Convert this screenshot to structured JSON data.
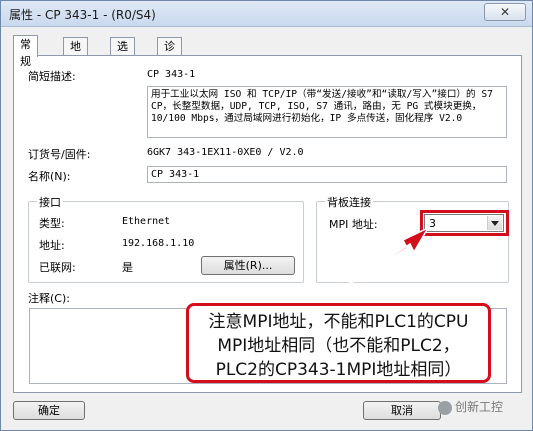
{
  "window": {
    "title": "属性 - CP 343-1 - (R0/S4)",
    "close_glyph": "✕"
  },
  "tabs": [
    {
      "label": "常规",
      "accel": ""
    },
    {
      "label": "地址",
      "accel": ""
    },
    {
      "label": "选项",
      "accel": ""
    },
    {
      "label": "诊断",
      "accel": ""
    }
  ],
  "general": {
    "short_desc_label": "简短描述:",
    "short_desc_value": "CP 343-1",
    "long_desc": "用于工业以太网 ISO 和 TCP/IP（带“发送/接收”和“读取/写入”接口）的 S7 CP，长整型数据，UDP, TCP, ISO, S7 通讯，路由，无 PG 式模块更换，10/100 Mbps，通过局域网进行初始化，IP 多点传送，固化程序 V2.0",
    "order_label": "订货号/固件:",
    "order_value": "6GK7 343-1EX11-0XE0 / V2.0",
    "name_label": "名称(N):",
    "name_value": "CP 343-1"
  },
  "interface": {
    "title": "接口",
    "type_label": "类型:",
    "type_value": "Ethernet",
    "address_label": "地址:",
    "address_value": "192.168.1.10",
    "networked_label": "已联网:",
    "networked_value": "是",
    "properties_button": "属性(R)..."
  },
  "backplane": {
    "title": "背板连接",
    "mpi_label": "MPI 地址:",
    "mpi_value": "3"
  },
  "comment": {
    "label": "注释(C):"
  },
  "buttons": {
    "ok": "确定",
    "cancel": "取消"
  },
  "annotation": {
    "line1": "注意MPI地址，不能和PLC1的CPU",
    "line2": "MPI地址相同（也不能和PLC2，",
    "line3": "PLC2的CP343-1MPI地址相同）",
    "color": "#d40d1c"
  },
  "watermark": {
    "text": "创新工控"
  }
}
